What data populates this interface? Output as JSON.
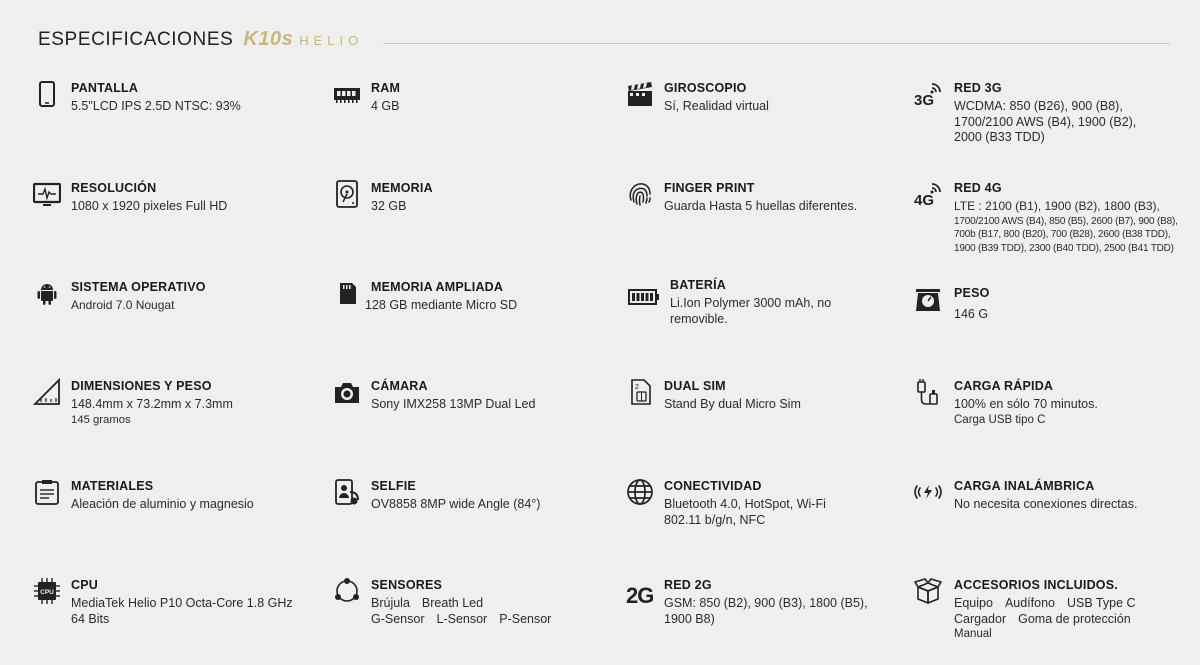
{
  "header": {
    "title": "ESPECIFICACIONES",
    "model": "K10s",
    "sub": "HELIO"
  },
  "specs": {
    "pantalla": {
      "label": "PANTALLA",
      "value": "5.5\"LCD IPS 2.5D NTSC: 93%",
      "icon": "smartphone-icon"
    },
    "ram": {
      "label": "RAM",
      "value": "4 GB",
      "icon": "ram-chip-icon"
    },
    "giroscopio": {
      "label": "GIROSCOPIO",
      "value": "Sí, Realidad virtual",
      "icon": "clapperboard-icon"
    },
    "red3g": {
      "label": "RED 3G",
      "value": "WCDMA: 850 (B26), 900 (B8), 1700/2100 AWS (B4), 1900 (B2), 2000 (B33 TDD)",
      "icon": "3g-signal-icon"
    },
    "resolucion": {
      "label": "RESOLUCIÓN",
      "value": "1080 x 1920 pixeles Full HD",
      "icon": "monitor-icon"
    },
    "memoria": {
      "label": "MEMORIA",
      "value": "32 GB",
      "icon": "hard-drive-icon"
    },
    "finger": {
      "label": "FINGER PRINT",
      "value": "Guarda Hasta 5 huellas diferentes.",
      "icon": "fingerprint-icon"
    },
    "red4g": {
      "label": "RED 4G",
      "value": "LTE : 2100 (B1), 1900 (B2), 1800 (B3),",
      "extra": "1700/2100 AWS (B4), 850 (B5), 2600 (B7), 900 (B8), 700b (B17, 800 (B20), 700 (B28), 2600 (B38 TDD), 1900 (B39 TDD), 2300 (B40 TDD), 2500 (B41 TDD)",
      "icon": "4g-signal-icon"
    },
    "sistema": {
      "label": "SISTEMA OPERATIVO",
      "value": "Android 7.0 Nougat",
      "icon": "android-icon"
    },
    "ampliada": {
      "label": "MEMORIA AMPLIADA",
      "value": "128 GB mediante Micro SD",
      "icon": "sd-card-icon"
    },
    "bateria": {
      "label": "BATERÍA",
      "value": "Li.Ion Polymer 3000 mAh, no removible.",
      "icon": "battery-icon"
    },
    "peso": {
      "label": "PESO",
      "value": "146 G",
      "icon": "scale-icon"
    },
    "dimensiones": {
      "label": "DIMENSIONES Y PESO",
      "value": "148.4mm x 73.2mm x 7.3mm",
      "value2": "145 gramos",
      "icon": "ruler-icon"
    },
    "camara": {
      "label": "CÁMARA",
      "value": "Sony IMX258 13MP Dual Led",
      "icon": "camera-icon"
    },
    "dualsim": {
      "label": "DUAL SIM",
      "value": "Stand By dual Micro Sim",
      "icon": "sim-card-icon"
    },
    "carga": {
      "label": "CARGA RÁPIDA",
      "value": "100% en sólo 70 minutos.",
      "value2": "Carga USB tipo C",
      "icon": "usb-charger-icon"
    },
    "materiales": {
      "label": "MATERIALES",
      "value": "Aleación de aluminio y magnesio",
      "icon": "clipboard-icon"
    },
    "selfie": {
      "label": "SELFIE",
      "value": "OV8858 8MP wide Angle (84°)",
      "icon": "selfie-icon"
    },
    "conectividad": {
      "label": "CONECTIVIDAD",
      "value": "Bluetooth 4.0, HotSpot, Wi-Fi 802.11 b/g/n, NFC",
      "icon": "globe-icon"
    },
    "inalambrica": {
      "label": "CARGA INALÁMBRICA",
      "value": "No necesita conexiones directas.",
      "icon": "wireless-charging-icon"
    },
    "cpu": {
      "label": "CPU",
      "value": "MediaTek Helio P10 Octa-Core 1.8 GHz 64 Bits",
      "icon": "cpu-icon",
      "icon_text": "CPU"
    },
    "sensores": {
      "label": "SENSORES",
      "items": [
        "Brújula",
        "Breath Led",
        "G-Sensor",
        "L-Sensor",
        "P-Sensor"
      ],
      "icon": "sensors-icon"
    },
    "red2g": {
      "label": "RED 2G",
      "value": "GSM: 850 (B2), 900 (B3), 1800 (B5), 1900 B8)",
      "icon": "2g-icon",
      "icon_text": "2G"
    },
    "accesorios": {
      "label": "ACCESORIOS INCLUIDOS.",
      "items": [
        "Equipo",
        "Audífono",
        "USB Type C",
        "Cargador",
        "Goma de protección",
        "Manual"
      ],
      "icon": "box-icon"
    }
  }
}
